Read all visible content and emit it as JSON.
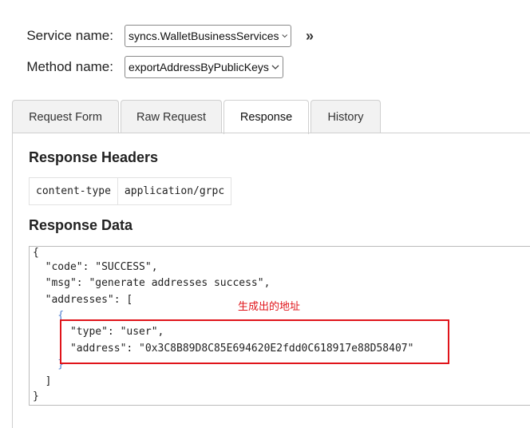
{
  "form": {
    "service_label": "Service name:",
    "service_value": "syncs.WalletBusinessServices",
    "method_label": "Method name:",
    "method_value": "exportAddressByPublicKeys",
    "expand_glyph": "»"
  },
  "tabs": [
    {
      "label": "Request Form",
      "active": false
    },
    {
      "label": "Raw Request",
      "active": false
    },
    {
      "label": "Response",
      "active": true
    },
    {
      "label": "History",
      "active": false
    }
  ],
  "response": {
    "headers_title": "Response Headers",
    "headers": [
      {
        "name": "content-type",
        "value": "application/grpc"
      }
    ],
    "data_title": "Response Data",
    "lines": [
      "{",
      "  \"code\": \"SUCCESS\",",
      "  \"msg\": \"generate addresses success\",",
      "  \"addresses\": [",
      "    {",
      "      \"type\": \"user\",",
      "      \"address\": \"0x3C8B89D8C85E694620E2fdd0C618917e88D58407\"",
      "    }",
      "  ]",
      "}"
    ],
    "annotation": "生成出的地址"
  },
  "colors": {
    "annotation": "#e0141a",
    "brace_highlight": "#4f7fd0"
  }
}
